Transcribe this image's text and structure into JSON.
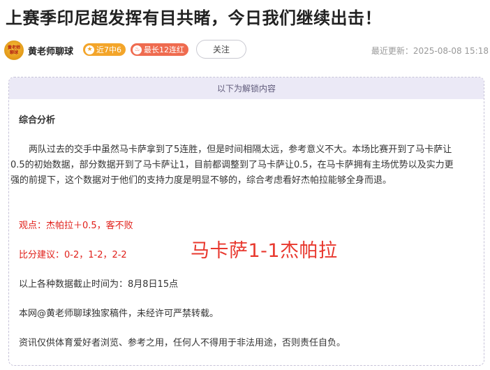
{
  "header": {
    "title": "上赛季印尼超发挥有目共睹，今日我们继续出击！"
  },
  "author": {
    "avatar_text_line1": "黄老师",
    "avatar_text_line2": "聊球",
    "name": "黄老师聊球",
    "badge_streak": "近7中6",
    "badge_red": "最长12连红",
    "follow_label": "关注",
    "updated": "最近更新：2025-08-08 15:18"
  },
  "colors": {
    "accent_red": "#e0201a",
    "badge_orange": "#f3a52a",
    "badge_red": "#ef6b4f",
    "banner_bg": "#ebe9f6"
  },
  "content": {
    "unlock_banner": "以下为解锁内容",
    "section_heading": "综合分析",
    "analysis": "两队过去的交手中虽然马卡萨拿到了5连胜，但是时间相隔太远，参考意义不大。本场比赛开到了马卡萨让0.5的初始数据，部分数据开到了马卡萨让1，目前都调整到了马卡萨让0.5，在马卡萨拥有主场优势以及实力更强的前提下，这个数据对于他们的支持力度是明显不够的，综合考虑看好杰帕拉能够全身而退。",
    "viewpoint": "观点：杰帕拉＋0.5，客不败",
    "score_suggestion": "比分建议：0-2，1-2，2-2",
    "score_overlay": "马卡萨1-1杰帕拉",
    "data_cutoff": "以上各种数据截止时间为：8月8日15点",
    "copyright": "本网@黄老师聊球独家稿件，未经许可严禁转载。",
    "disclaimer": "资讯仅供体育爱好者浏览、参考之用，任何人不得用于非法用途，否则责任自负。"
  }
}
